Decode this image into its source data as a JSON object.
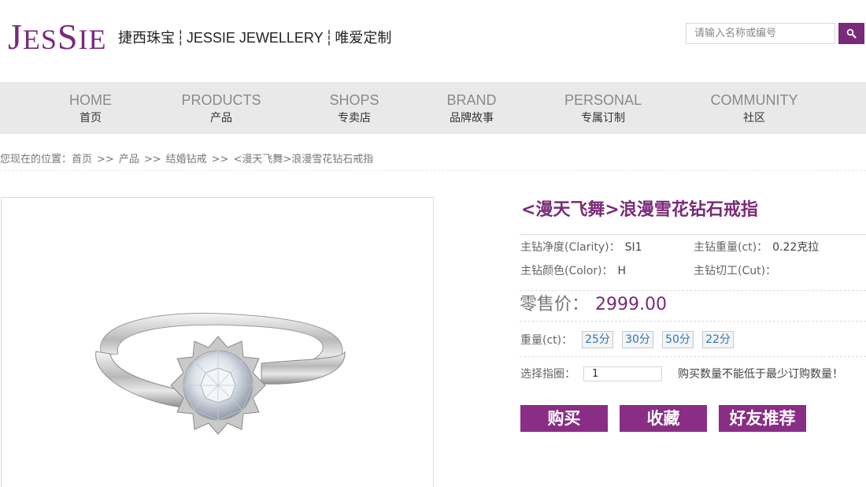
{
  "header": {
    "logo": {
      "j": "J",
      "es": "ES",
      "s": "S",
      "ie": "IE"
    },
    "tagline": {
      "part1": "捷西珠宝",
      "separator": "┆",
      "part2": "JESSIE JEWELLERY",
      "part3": "唯爱定制"
    },
    "search": {
      "placeholder": "请输入名称或编号"
    }
  },
  "nav": {
    "items": [
      {
        "en": "HOME",
        "cn": "首页"
      },
      {
        "en": "PRODUCTS",
        "cn": "产品"
      },
      {
        "en": "SHOPS",
        "cn": "专卖店"
      },
      {
        "en": "BRAND",
        "cn": "品牌故事"
      },
      {
        "en": "PERSONAL",
        "cn": "专属订制"
      },
      {
        "en": "COMMUNITY",
        "cn": "社区"
      }
    ]
  },
  "breadcrumb": {
    "prefix": "您现在的位置：",
    "items": [
      "首页",
      "产品",
      "结婚钻戒",
      "<漫天飞舞>浪漫雪花钻石戒指"
    ],
    "separator": ">>"
  },
  "product": {
    "title": "<漫天飞舞>浪漫雪花钻石戒指",
    "specs": {
      "clarity": {
        "label": "主钻净度(Clarity)：",
        "value": "SI1"
      },
      "weight": {
        "label": "主钻重量(ct)：",
        "value": "0.22克拉"
      },
      "color": {
        "label": "主钻颜色(Color)：",
        "value": "H"
      },
      "cut": {
        "label": "主钻切工(Cut)：",
        "value": ""
      }
    },
    "price": {
      "label": "零售价：",
      "value": "2999.00"
    },
    "weight_options": {
      "label": "重量(ct)：",
      "options": [
        "25分",
        "30分",
        "50分",
        "22分"
      ]
    },
    "ring_size": {
      "label": "选择指圈：",
      "value": "1",
      "note": "购买数量不能低于最少订购数量！"
    },
    "actions": {
      "buy": "购买",
      "favorite": "收藏",
      "recommend": "好友推荐"
    }
  },
  "colors": {
    "brand": "#7a2a78",
    "button": "#8a2d86",
    "nav_bg": "#e9e9e9",
    "option_text": "#2a7bbf"
  },
  "icons": {
    "search": "search-icon"
  }
}
